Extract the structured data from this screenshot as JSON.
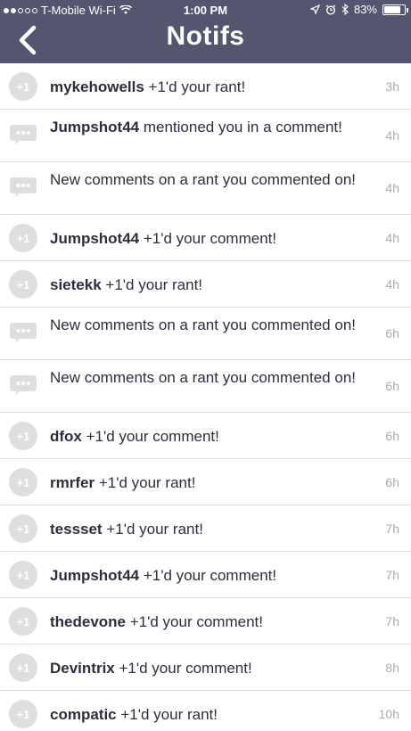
{
  "status_bar": {
    "carrier": "T-Mobile Wi-Fi",
    "time": "1:00 PM",
    "battery": "83%",
    "battery_level": 0.83
  },
  "header": {
    "title": "Notifs"
  },
  "colors": {
    "header_bg": "#54556e",
    "avatar_bg": "#dedede",
    "text": "#2d2e3b",
    "time": "#aaaaaa"
  },
  "notifications": [
    {
      "icon": "plus-one-icon",
      "user": "mykehowells",
      "message": " +1'd your rant!",
      "time": "3h"
    },
    {
      "icon": "comment-bubble-icon",
      "user": "Jumpshot44",
      "message": " mentioned you in a comment!",
      "time": "4h"
    },
    {
      "icon": "comment-bubble-icon",
      "user": "",
      "message": "New comments on a rant you commented on!",
      "time": "4h"
    },
    {
      "icon": "plus-one-icon",
      "user": "Jumpshot44",
      "message": " +1'd your comment!",
      "time": "4h"
    },
    {
      "icon": "plus-one-icon",
      "user": "sietekk",
      "message": " +1'd your rant!",
      "time": "4h"
    },
    {
      "icon": "comment-bubble-icon",
      "user": "",
      "message": "New comments on a rant you commented on!",
      "time": "6h"
    },
    {
      "icon": "comment-bubble-icon",
      "user": "",
      "message": "New comments on a rant you commented on!",
      "time": "6h"
    },
    {
      "icon": "plus-one-icon",
      "user": "dfox",
      "message": " +1'd your comment!",
      "time": "6h"
    },
    {
      "icon": "plus-one-icon",
      "user": "rmrfer",
      "message": " +1'd your rant!",
      "time": "6h"
    },
    {
      "icon": "plus-one-icon",
      "user": "tessset",
      "message": " +1'd your rant!",
      "time": "7h"
    },
    {
      "icon": "plus-one-icon",
      "user": "Jumpshot44",
      "message": " +1'd your comment!",
      "time": "7h"
    },
    {
      "icon": "plus-one-icon",
      "user": "thedevone",
      "message": " +1'd your comment!",
      "time": "7h"
    },
    {
      "icon": "plus-one-icon",
      "user": "Devintrix",
      "message": " +1'd your comment!",
      "time": "8h"
    },
    {
      "icon": "plus-one-icon",
      "user": "compatic",
      "message": " +1'd your rant!",
      "time": "10h"
    }
  ],
  "plus_one_label": "+1"
}
